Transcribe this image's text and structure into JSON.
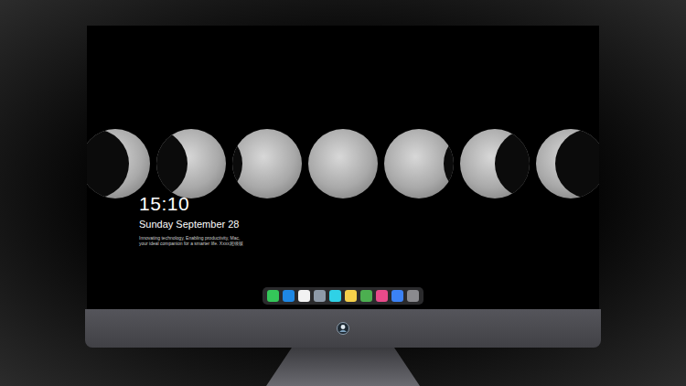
{
  "lock_screen": {
    "time": "15:10",
    "date": "Sunday September 28",
    "tagline": "Innovating technology, Enabling productivity, Mac, your ideal companion for a smarter life. Xxxx超级版"
  },
  "wallpaper": {
    "moons": [
      {
        "level": 0.3,
        "side": "right"
      },
      {
        "level": 0.55,
        "side": "right"
      },
      {
        "level": 0.85,
        "side": "right"
      },
      {
        "level": 1,
        "side": "right"
      },
      {
        "level": 0.85,
        "side": "left"
      },
      {
        "level": 0.5,
        "side": "left"
      },
      {
        "level": 0.28,
        "side": "left"
      }
    ]
  },
  "dock": {
    "apps": [
      {
        "color": "#34c759"
      },
      {
        "color": "#1e88e5"
      },
      {
        "color": "#f2f2f2"
      },
      {
        "color": "#8e9aa8"
      },
      {
        "color": "#2fd1e6"
      },
      {
        "color": "#f5d04a"
      },
      {
        "color": "#4caf50"
      },
      {
        "color": "#e84a8a"
      },
      {
        "color": "#3b82f6"
      },
      {
        "color": "#8a8a8e"
      }
    ]
  }
}
